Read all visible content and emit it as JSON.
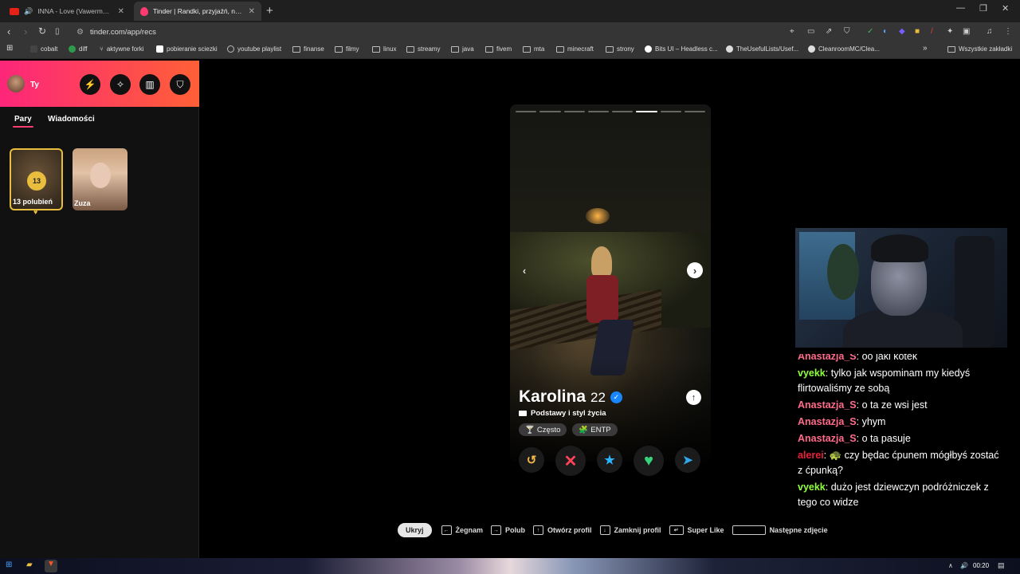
{
  "browser": {
    "tabs": [
      {
        "title": "INNA - Love (Vawerman 'VIXA' B...",
        "icon": "youtube-icon"
      },
      {
        "title": "Tinder | Randki, przyjaźń, nowe ...",
        "icon": "tinder-flame-icon"
      }
    ],
    "url": "tinder.com/app/recs",
    "bookmarks": [
      {
        "label": "cobalt",
        "icon": "cobalt-icon"
      },
      {
        "label": "diff",
        "icon": "diff-icon"
      },
      {
        "label": "aktywne forki",
        "icon": "fork-icon"
      },
      {
        "label": "pobieranie sciezki",
        "icon": "download-icon"
      },
      {
        "label": "youtube playlist",
        "icon": "globe-icon"
      },
      {
        "label": "finanse",
        "icon": "folder-icon"
      },
      {
        "label": "filmy",
        "icon": "folder-icon"
      },
      {
        "label": "linux",
        "icon": "folder-icon"
      },
      {
        "label": "streamy",
        "icon": "folder-icon"
      },
      {
        "label": "java",
        "icon": "folder-icon"
      },
      {
        "label": "fivem",
        "icon": "folder-icon"
      },
      {
        "label": "mta",
        "icon": "folder-icon"
      },
      {
        "label": "minecraft",
        "icon": "folder-icon"
      },
      {
        "label": "strony",
        "icon": "folder-icon"
      },
      {
        "label": "Bits UI – Headless c...",
        "icon": "bits-ui-icon"
      },
      {
        "label": "TheUsefulLists/Usef...",
        "icon": "github-icon"
      },
      {
        "label": "CleanroomMC/Clea...",
        "icon": "github-icon"
      }
    ],
    "all_bookmarks": "Wszystkie zakładki"
  },
  "sidebar": {
    "user_name": "Ty",
    "tabs": [
      {
        "label": "Pary",
        "active": true
      },
      {
        "label": "Wiadomości",
        "active": false
      }
    ],
    "likes_count": "13",
    "likes_label": "13 polubień",
    "matches": [
      {
        "name": "Zuza"
      }
    ]
  },
  "profile": {
    "name": "Karolina",
    "age": "22",
    "verified": true,
    "photo_count": 8,
    "current_photo": 6,
    "section": "Podstawy i styl życia",
    "chips": [
      {
        "label": "Często",
        "icon": "drink-icon"
      },
      {
        "label": "ENTP",
        "icon": "personality-icon"
      }
    ],
    "actions": [
      {
        "name": "rewind",
        "color": "#f5b748"
      },
      {
        "name": "nope",
        "color": "#ff4458"
      },
      {
        "name": "super-like",
        "color": "#2db5ff"
      },
      {
        "name": "like",
        "color": "#35d47a"
      },
      {
        "name": "boost",
        "color": "#30a8f0"
      }
    ]
  },
  "hints": {
    "hide": "Ukryj",
    "items": [
      {
        "key": "←",
        "label": "Żegnam"
      },
      {
        "key": "→",
        "label": "Polub"
      },
      {
        "key": "↑",
        "label": "Otwórz profil"
      },
      {
        "key": "↓",
        "label": "Zamknij profil"
      },
      {
        "key": "↵",
        "label": "Super Like"
      },
      {
        "key": "",
        "label": "Następne zdjęcie"
      }
    ]
  },
  "chat": [
    {
      "user": "Anastazja_S",
      "color": "#ff6b8a",
      "text": "oo jaki kotek",
      "cut": true
    },
    {
      "user": "vyekk",
      "color": "#8fff3a",
      "text": "tylko jak wspominam my kiedyś flirtowaliśmy ze sobą"
    },
    {
      "user": "Anastazja_S",
      "color": "#ff6b8a",
      "text": "o ta ze wsi jest"
    },
    {
      "user": "Anastazja_S",
      "color": "#ff6b8a",
      "text": "yhym"
    },
    {
      "user": "Anastazja_S",
      "color": "#ff6b8a",
      "text": "o ta pasuje"
    },
    {
      "user": "alerei",
      "color": "#e8203a",
      "text": "🐢 czy będac ćpunem mógłbyś zostać z ćpunką?"
    },
    {
      "user": "vyekk",
      "color": "#8fff3a",
      "text": "dużo jest dziewczyn podróżniczek z tego co widze"
    }
  ],
  "taskbar": {
    "time": "00:20"
  }
}
